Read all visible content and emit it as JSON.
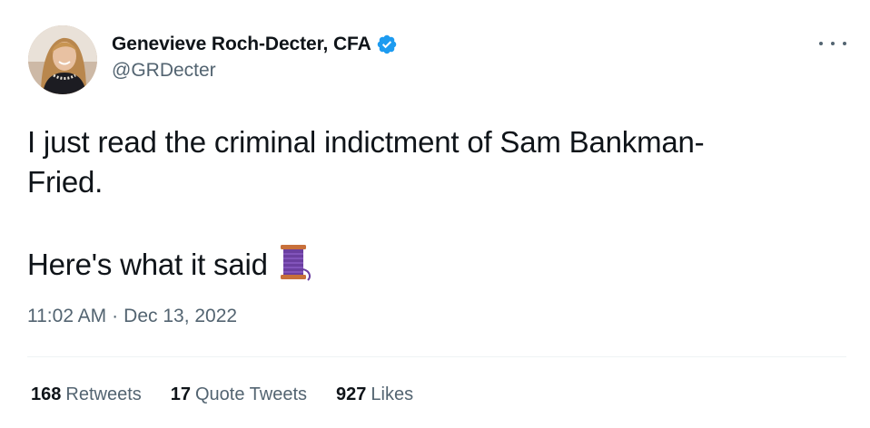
{
  "author": {
    "display_name": "Genevieve Roch-Decter, CFA",
    "handle": "@GRDecter",
    "verified_icon": "verified-badge-icon",
    "verified_color": "#1d9bf0"
  },
  "tweet": {
    "lines": [
      "I just read the criminal indictment of Sam Bankman-",
      "Fried.",
      "Here's what it said"
    ],
    "emoji_icon": "thread-spool-icon",
    "time": "11:02 AM",
    "separator": "·",
    "date": "Dec 13, 2022"
  },
  "stats": {
    "retweets_count": "168",
    "retweets_label": "Retweets",
    "quotes_count": "17",
    "quotes_label": "Quote Tweets",
    "likes_count": "927",
    "likes_label": "Likes"
  },
  "menu": {
    "more_icon": "more-options-icon"
  },
  "colors": {
    "text_primary": "#0f1419",
    "text_secondary": "#536471",
    "divider": "#eff3f4",
    "spool_thread": "#6b3fa0",
    "spool_wood": "#c8703a"
  }
}
